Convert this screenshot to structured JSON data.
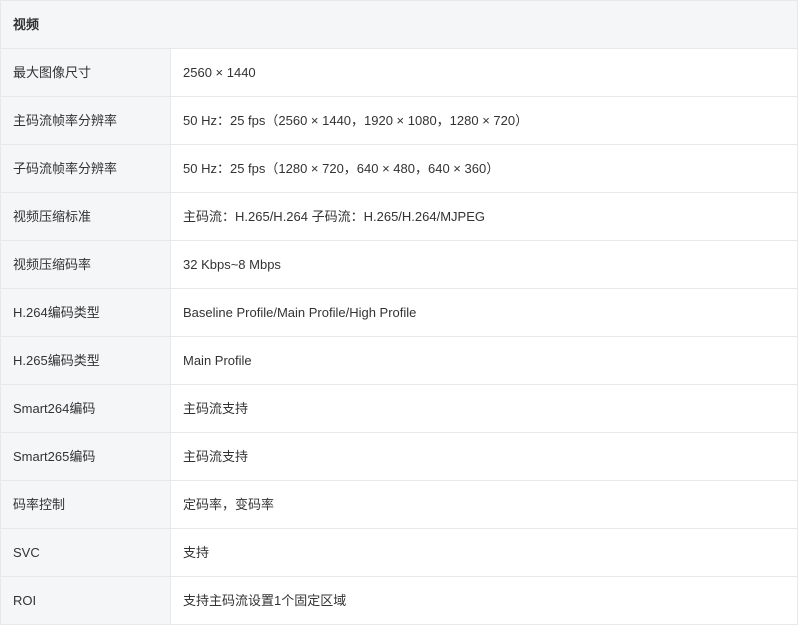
{
  "section": {
    "title": "视频"
  },
  "rows": [
    {
      "label": "最大图像尺寸",
      "value": "2560 × 1440"
    },
    {
      "label": "主码流帧率分辨率",
      "value": "50 Hz：25 fps（2560 × 1440，1920 × 1080，1280 × 720）"
    },
    {
      "label": "子码流帧率分辨率",
      "value": "50 Hz：25 fps（1280 × 720，640 × 480，640 × 360）"
    },
    {
      "label": "视频压缩标准",
      "value": "主码流：H.265/H.264 子码流：H.265/H.264/MJPEG"
    },
    {
      "label": "视频压缩码率",
      "value": "32 Kbps~8 Mbps"
    },
    {
      "label": "H.264编码类型",
      "value": "Baseline Profile/Main Profile/High Profile"
    },
    {
      "label": "H.265编码类型",
      "value": "Main Profile"
    },
    {
      "label": "Smart264编码",
      "value": "主码流支持"
    },
    {
      "label": "Smart265编码",
      "value": "主码流支持"
    },
    {
      "label": "码率控制",
      "value": "定码率，变码率"
    },
    {
      "label": "SVC",
      "value": "支持"
    },
    {
      "label": "ROI",
      "value": "支持主码流设置1个固定区域"
    }
  ]
}
